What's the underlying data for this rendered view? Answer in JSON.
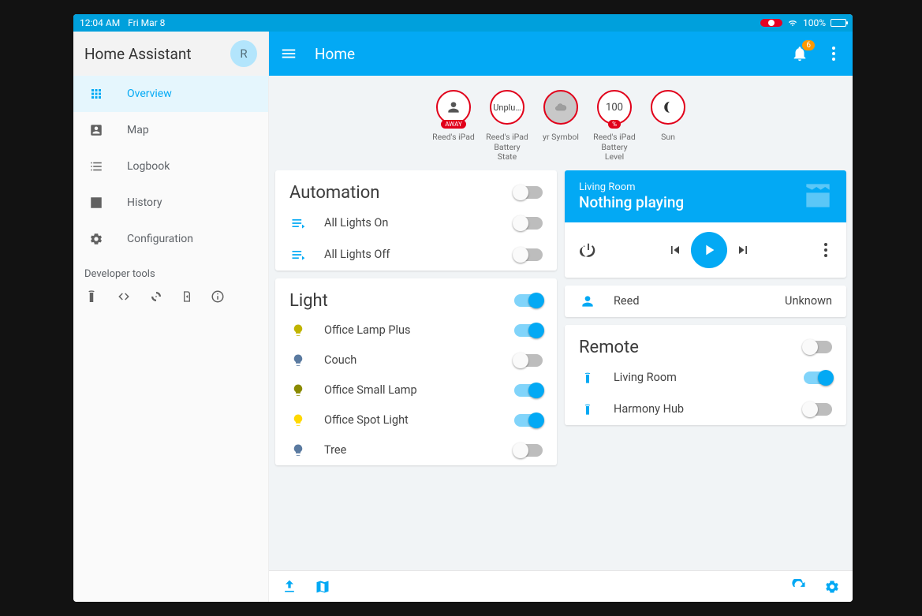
{
  "statusbar": {
    "time": "12:04 AM",
    "date": "Fri Mar 8",
    "battery": "100%"
  },
  "sidebar": {
    "title": "Home Assistant",
    "avatar_initial": "R",
    "items": [
      {
        "label": "Overview"
      },
      {
        "label": "Map"
      },
      {
        "label": "Logbook"
      },
      {
        "label": "History"
      },
      {
        "label": "Configuration"
      }
    ],
    "dev_label": "Developer tools"
  },
  "appbar": {
    "title": "Home",
    "notifications": "6"
  },
  "badges": [
    {
      "text": "",
      "sub": "AWAY",
      "label": "Reed's iPad",
      "icon": "person"
    },
    {
      "text": "Unplu…",
      "sub": "",
      "label": "Reed's iPad Battery State",
      "icon": ""
    },
    {
      "text": "",
      "sub": "",
      "label": "yr Symbol",
      "icon": "cloud"
    },
    {
      "text": "100",
      "sub": "%",
      "label": "Reed's iPad Battery Level",
      "icon": ""
    },
    {
      "text": "",
      "sub": "",
      "label": "Sun",
      "icon": "moon"
    }
  ],
  "automation": {
    "title": "Automation",
    "items": [
      {
        "label": "All Lights On",
        "on": false
      },
      {
        "label": "All Lights Off",
        "on": false
      }
    ],
    "master_on": false
  },
  "light": {
    "title": "Light",
    "master_on": true,
    "items": [
      {
        "label": "Office Lamp Plus",
        "on": true,
        "color": "#c0b400"
      },
      {
        "label": "Couch",
        "on": false,
        "color": "#5a7aa0"
      },
      {
        "label": "Office Small Lamp",
        "on": true,
        "color": "#8a8a00"
      },
      {
        "label": "Office Spot Light",
        "on": true,
        "color": "#ffd800"
      },
      {
        "label": "Tree",
        "on": false,
        "color": "#5a7aa0"
      }
    ]
  },
  "media": {
    "room": "Living Room",
    "title": "Nothing playing"
  },
  "person": {
    "name": "Reed",
    "state": "Unknown"
  },
  "remote": {
    "title": "Remote",
    "master_on": false,
    "items": [
      {
        "label": "Living Room",
        "on": true
      },
      {
        "label": "Harmony Hub",
        "on": false
      }
    ]
  }
}
